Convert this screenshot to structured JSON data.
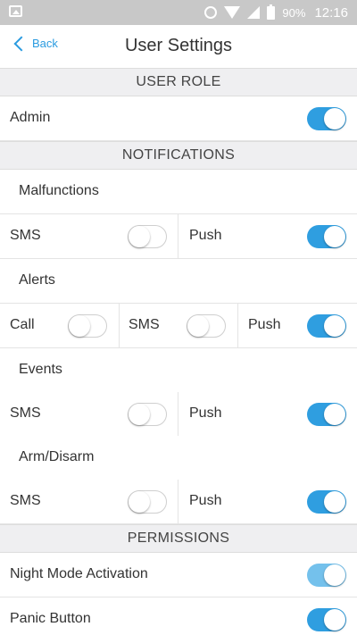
{
  "status_bar": {
    "battery": "90%",
    "time": "12:16",
    "icons": [
      "image-icon",
      "alarm-icon",
      "wifi-icon",
      "signal-icon",
      "battery-icon"
    ]
  },
  "header": {
    "back_label": "Back",
    "title": "User Settings"
  },
  "sections": {
    "user_role": "USER ROLE",
    "notifications": "NOTIFICATIONS",
    "permissions": "PERMISSIONS"
  },
  "user_role": {
    "label": "Admin",
    "enabled": true
  },
  "notifications": {
    "malfunctions": {
      "label": "Malfunctions",
      "sms": "SMS",
      "sms_on": false,
      "push": "Push",
      "push_on": true
    },
    "alerts": {
      "label": "Alerts",
      "call": "Call",
      "call_on": false,
      "sms": "SMS",
      "sms_on": false,
      "push": "Push",
      "push_on": true
    },
    "events": {
      "label": "Events",
      "sms": "SMS",
      "sms_on": false,
      "push": "Push",
      "push_on": true
    },
    "arm_disarm": {
      "label": "Arm/Disarm",
      "sms": "SMS",
      "sms_on": false,
      "push": "Push",
      "push_on": true
    }
  },
  "permissions": {
    "night_mode": {
      "label": "Night Mode Activation",
      "enabled": true
    },
    "panic_button": {
      "label": "Panic Button",
      "enabled": true
    }
  },
  "colors": {
    "accent": "#2f9ee0",
    "accent_light": "#74c1ec",
    "section_bg": "#efeff1",
    "status_bar": "#c8c8c8"
  }
}
